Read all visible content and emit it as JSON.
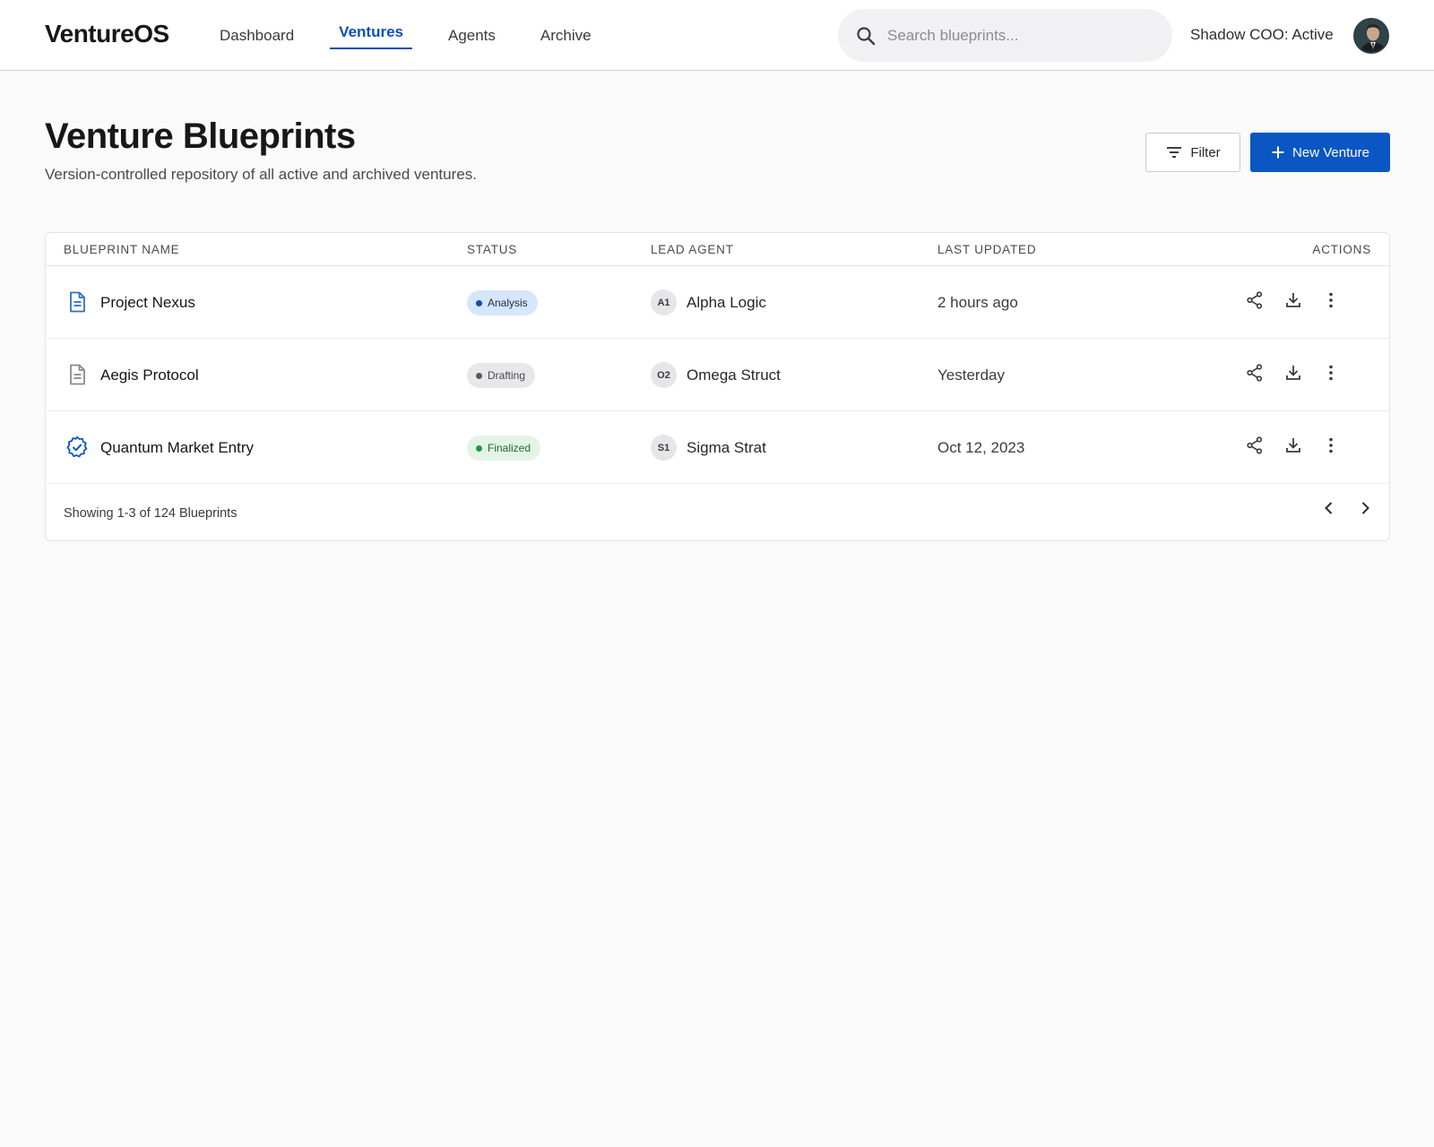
{
  "app": {
    "logo": "VentureOS"
  },
  "nav": {
    "items": [
      {
        "label": "Dashboard",
        "active": false
      },
      {
        "label": "Ventures",
        "active": true
      },
      {
        "label": "Agents",
        "active": false
      },
      {
        "label": "Archive",
        "active": false
      }
    ]
  },
  "search": {
    "placeholder": "Search blueprints...",
    "value": ""
  },
  "header": {
    "status": "Shadow COO: Active"
  },
  "page": {
    "title": "Venture Blueprints",
    "subtitle": "Version-controlled repository of all active and archived ventures."
  },
  "toolbar": {
    "filter_label": "Filter",
    "new_label": "New Venture"
  },
  "table": {
    "columns": [
      "BLUEPRINT NAME",
      "STATUS",
      "LEAD AGENT",
      "LAST UPDATED",
      "ACTIONS"
    ],
    "rows": [
      {
        "icon": "document-icon",
        "icon_color": "#2f6fc4",
        "name": "Project Nexus",
        "status": "Analysis",
        "status_bg": "#d6e6fb",
        "status_dot": "#0a4fb4",
        "status_text": "#1d2c44",
        "agent_initials": "A1",
        "agent": "Alpha Logic",
        "updated": "2 hours ago"
      },
      {
        "icon": "document-icon",
        "icon_color": "#8a8a8e",
        "name": "Aegis Protocol",
        "status": "Drafting",
        "status_bg": "#e8e8ea",
        "status_dot": "#5a5a5e",
        "status_text": "#4a4a4e",
        "agent_initials": "O2",
        "agent": "Omega Struct",
        "updated": "Yesterday"
      },
      {
        "icon": "verified-badge-icon",
        "icon_color": "#0a56c2",
        "name": "Quantum Market Entry",
        "status": "Finalized",
        "status_bg": "#e3f4e6",
        "status_dot": "#1e9a3c",
        "status_text": "#1f6b33",
        "agent_initials": "S1",
        "agent": "Sigma Strat",
        "updated": "Oct 12, 2023"
      }
    ],
    "footer": "Showing 1-3 of 124 Blueprints"
  }
}
